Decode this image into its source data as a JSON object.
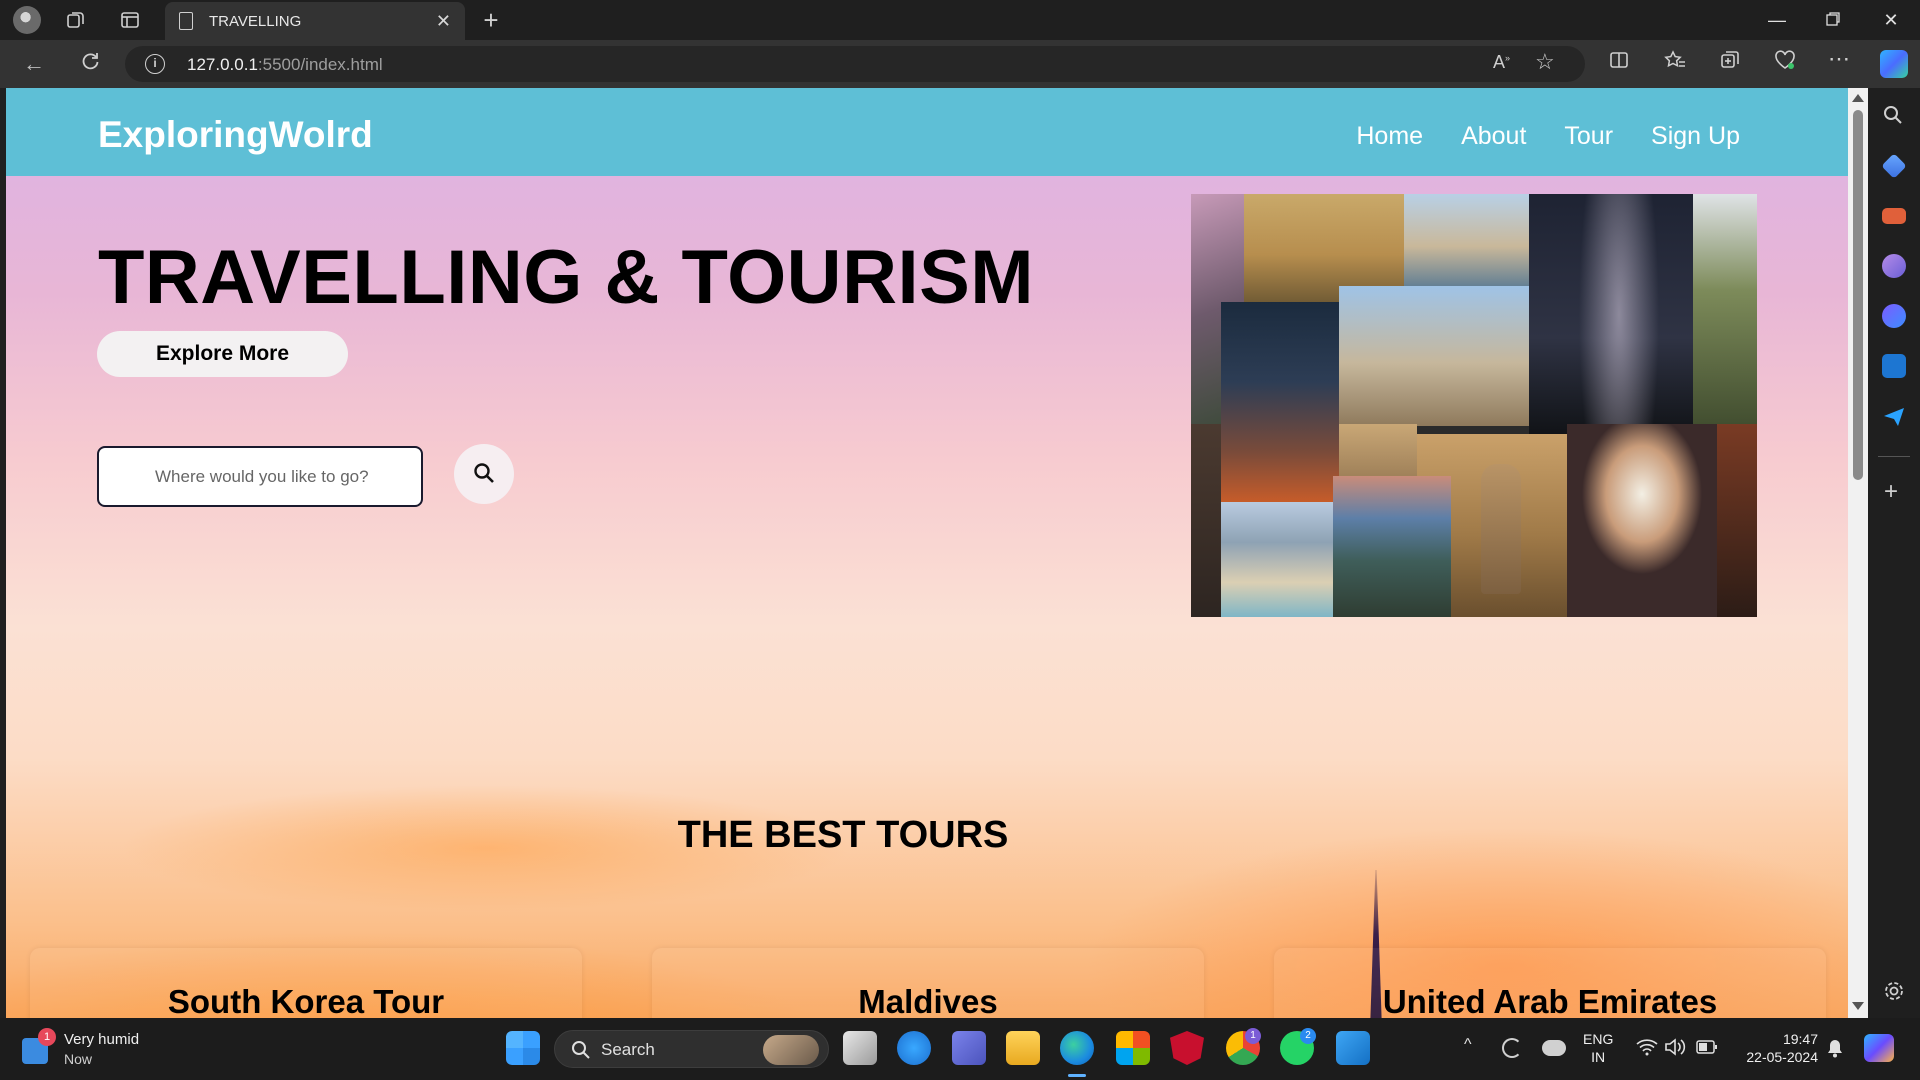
{
  "browser": {
    "tab_title": "TRAVELLING",
    "url_host": "127.0.0.1",
    "url_path": ":5500/index.html",
    "accent": "#5ebfd6"
  },
  "site": {
    "logo": "ExploringWolrd",
    "nav": [
      "Home",
      "About",
      "Tour",
      "Sign Up"
    ],
    "hero_title": "TRAVELLING & TOURISM",
    "explore_button": "Explore More",
    "search_placeholder": "Where would you like to go?",
    "section_title": "THE BEST TOURS",
    "tours": [
      "South Korea Tour",
      "Maldives",
      "United Arab Emirates"
    ]
  },
  "taskbar": {
    "weather_text": "Very humid",
    "weather_sub": "Now",
    "weather_badge": "1",
    "search_label": "Search",
    "lang_top": "ENG",
    "lang_bottom": "IN",
    "time": "19:47",
    "date": "22-05-2024",
    "teams_badge": "1",
    "whatsapp_badge": "2"
  }
}
